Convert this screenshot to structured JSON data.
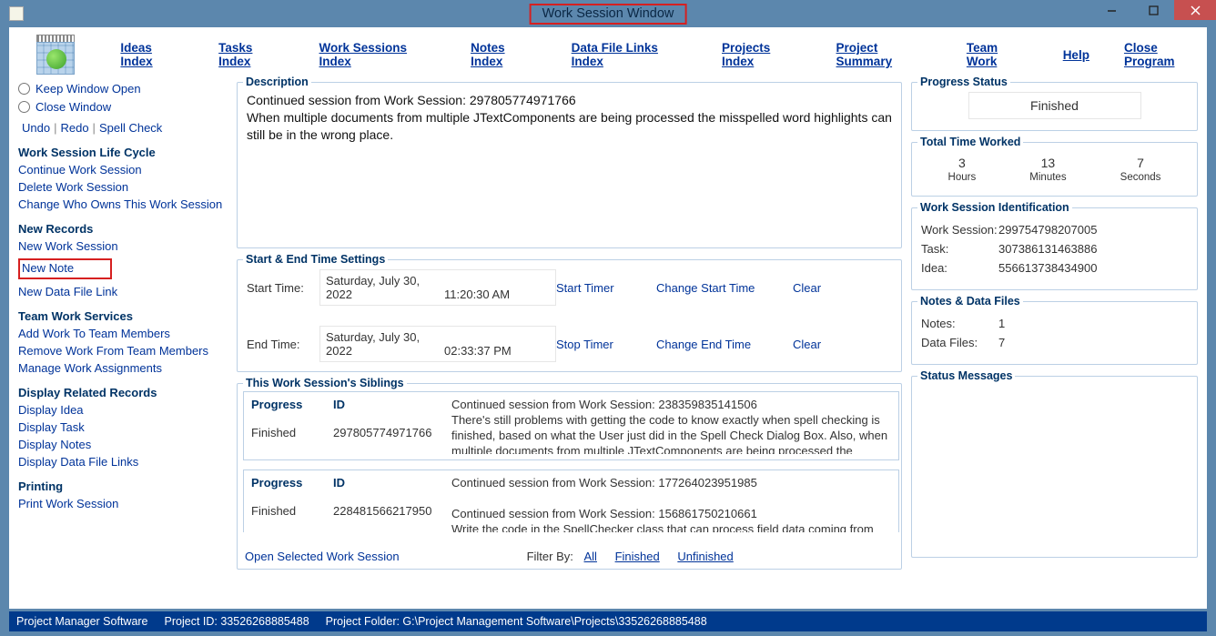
{
  "window": {
    "title": "Work Session Window"
  },
  "menu": {
    "ideas": "Ideas Index",
    "tasks": "Tasks Index",
    "wsidx": "Work Sessions Index",
    "notes": "Notes Index",
    "dflinks": "Data File Links Index",
    "projects": "Projects Index",
    "summary": "Project Summary",
    "teamwork": "Team Work",
    "help": "Help",
    "close": "Close Program"
  },
  "left": {
    "keep_open": "Keep Window Open",
    "close_win": "Close Window",
    "undo": "Undo",
    "redo": "Redo",
    "spell": "Spell Check",
    "life_head": "Work Session Life Cycle",
    "cont": "Continue Work Session",
    "del": "Delete Work Session",
    "chown": "Change Who Owns This Work Session",
    "new_head": "New Records",
    "new_ws": "New Work Session",
    "new_note": "New Note",
    "new_df": "New Data File Link",
    "team_head": "Team Work Services",
    "addwork": "Add Work To Team Members",
    "remwork": "Remove Work From Team Members",
    "manwork": "Manage Work Assignments",
    "disp_head": "Display Related Records",
    "didea": "Display Idea",
    "dtask": "Display Task",
    "dnotes": "Display Notes",
    "ddf": "Display Data File Links",
    "print_head": "Printing",
    "print": "Print Work Session"
  },
  "center": {
    "desc_legend": "Description",
    "desc_line1": "Continued session from Work Session: 297805774971766",
    "desc_line2": "When multiple documents from multiple JTextComponents are being processed the misspelled word highlights can still be in the wrong place.",
    "time_legend": "Start & End Time Settings",
    "start_lbl": "Start Time:",
    "start_date": "Saturday, July 30, 2022",
    "start_time": "11:20:30 AM",
    "end_lbl": "End Time:",
    "end_date": "Saturday, July 30, 2022",
    "end_time": "02:33:37 PM",
    "start_timer": "Start Timer",
    "stop_timer": "Stop Timer",
    "chg_start": "Change Start Time",
    "chg_end": "Change End Time",
    "clear": "Clear",
    "sib_legend": "This Work Session's Siblings",
    "sib": [
      {
        "prog_h": "Progress",
        "id_h": "ID",
        "prog": "Finished",
        "id": "297805774971766",
        "txt": "Continued session from Work Session: 238359835141506\nThere's still problems with getting the code to know exactly when spell checking is finished, based on what the User just did in the Spell Check Dialog Box. Also, when multiple documents from multiple JTextComponents are being processed the"
      },
      {
        "prog_h": "Progress",
        "id_h": "ID",
        "prog": "Finished",
        "id": "228481566217950",
        "txt": "Continued session from Work Session: 177264023951985\n\nContinued session from Work Session: 156861750210661\nWrite the code in the SpellChecker class that can process field data coming from"
      }
    ],
    "open_sel": "Open Selected Work Session",
    "filter_by": "Filter By:",
    "f_all": "All",
    "f_fin": "Finished",
    "f_unf": "Unfinished"
  },
  "right": {
    "status_legend": "Progress Status",
    "status_val": "Finished",
    "ttw_legend": "Total Time Worked",
    "hours": "3",
    "hours_l": "Hours",
    "mins": "13",
    "mins_l": "Minutes",
    "secs": "7",
    "secs_l": "Seconds",
    "id_legend": "Work Session Identification",
    "ws_k": "Work Session:",
    "ws_v": "299754798207005",
    "task_k": "Task:",
    "task_v": "307386131463886",
    "idea_k": "Idea:",
    "idea_v": "556613738434900",
    "ndf_legend": "Notes & Data Files",
    "notes_k": "Notes:",
    "notes_v": "1",
    "df_k": "Data Files:",
    "df_v": "7",
    "msg_legend": "Status Messages"
  },
  "statusbar": {
    "app": "Project Manager Software",
    "pid": "Project ID: 33526268885488",
    "pfolder": "Project Folder: G:\\Project Management Software\\Projects\\33526268885488"
  }
}
